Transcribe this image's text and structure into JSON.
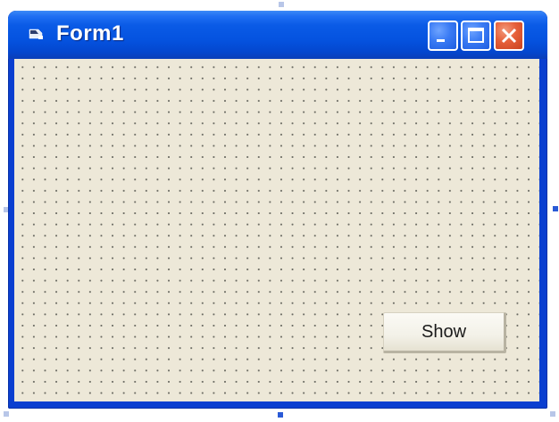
{
  "window": {
    "title": "Form1",
    "icon": "form-icon"
  },
  "caption_buttons": {
    "minimize_icon": "minimize-icon",
    "maximize_icon": "maximize-icon",
    "close_icon": "close-icon"
  },
  "form": {
    "show_button_label": "Show"
  },
  "colors": {
    "titlebar": "#0553e0",
    "frame": "#0a3fd0",
    "client_background": "#ede8d8",
    "close_button": "#e6603a"
  }
}
